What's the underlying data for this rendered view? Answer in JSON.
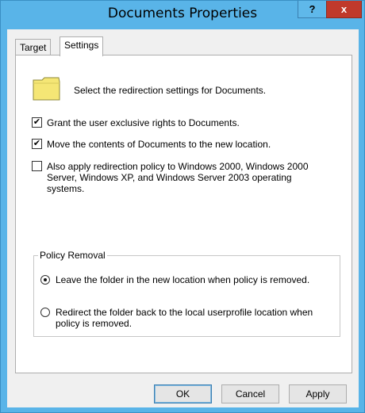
{
  "window": {
    "title": "Documents Properties",
    "help_glyph": "?",
    "close_glyph": "x"
  },
  "tabs": [
    {
      "label": "Target",
      "selected": false
    },
    {
      "label": "Settings",
      "selected": true
    }
  ],
  "settings": {
    "description": "Select the redirection settings for Documents.",
    "checkboxes": [
      {
        "label": "Grant the user exclusive rights to Documents.",
        "checked": true
      },
      {
        "label": "Move the contents of Documents to the new location.",
        "checked": true
      },
      {
        "label_lines": [
          "Also apply redirection policy to Windows 2000, Windows 2000",
          "Server, Windows XP, and Windows Server 2003 operating",
          "systems."
        ],
        "checked": false
      }
    ],
    "policy_removal": {
      "title": "Policy Removal",
      "options": [
        {
          "label": "Leave the folder in the new location when policy is removed.",
          "selected": true
        },
        {
          "label_lines": [
            "Redirect the folder back to the local userprofile location when",
            "policy is removed."
          ],
          "selected": false
        }
      ]
    }
  },
  "buttons": {
    "ok": "OK",
    "cancel": "Cancel",
    "apply": "Apply"
  },
  "colors": {
    "frame": "#59b4e8",
    "close": "#c0392b",
    "folder": "#f5e675"
  },
  "icons": {
    "folder": "folder-icon",
    "check": "checkmark-icon"
  }
}
